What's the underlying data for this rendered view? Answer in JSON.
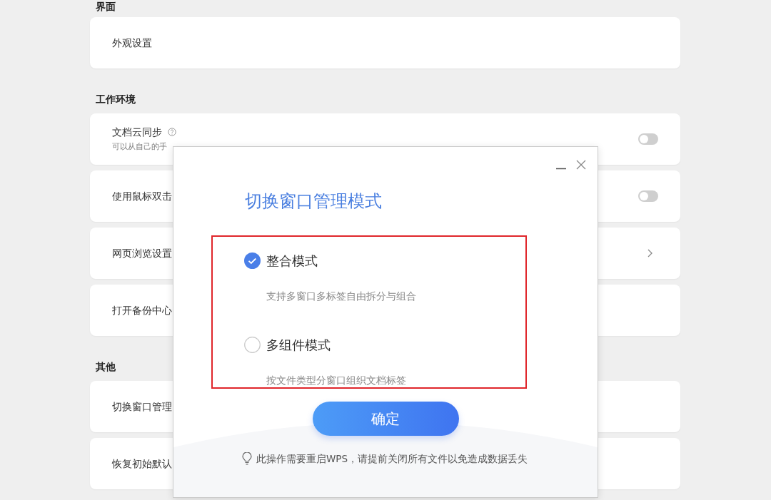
{
  "sections": [
    {
      "title": "界面",
      "items": [
        {
          "label": "外观设置",
          "kind": "plain"
        }
      ]
    },
    {
      "title": "工作环境",
      "items": [
        {
          "label": "文档云同步",
          "kind": "toggle",
          "on": false,
          "help": true,
          "description": "可以从自己的手"
        },
        {
          "label": "使用鼠标双击",
          "kind": "toggle",
          "on": false
        },
        {
          "label": "网页浏览设置",
          "kind": "chevron"
        },
        {
          "label": "打开备份中心",
          "kind": "plain"
        }
      ]
    },
    {
      "title": "其他",
      "items": [
        {
          "label": "切换窗口管理",
          "kind": "plain"
        },
        {
          "label": "恢复初始默认",
          "kind": "plain"
        }
      ]
    }
  ],
  "dialog": {
    "title": "切换窗口管理模式",
    "options": [
      {
        "label": "整合模式",
        "description": "支持多窗口多标签自由拆分与组合",
        "selected": true
      },
      {
        "label": "多组件模式",
        "description": "按文件类型分窗口组织文档标签",
        "selected": false
      }
    ],
    "confirm_button": "确定",
    "hint": "此操作需要重启WPS，请提前关闭所有文件以免造成数据丢失"
  }
}
